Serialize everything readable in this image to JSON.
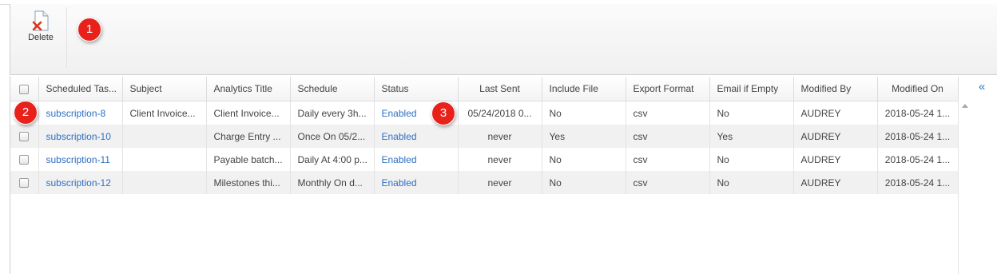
{
  "toolbar": {
    "delete_label": "Delete"
  },
  "badges": [
    "1",
    "2",
    "3"
  ],
  "table": {
    "columns": [
      "Scheduled Tas...",
      "Subject",
      "Analytics Title",
      "Schedule",
      "Status",
      "Last Sent",
      "Include File",
      "Export Format",
      "Email if Empty",
      "Modified By",
      "Modified On"
    ],
    "rows": [
      {
        "name": "subscription-8",
        "subject": "Client Invoice...",
        "title": "Client Invoice...",
        "schedule": "Daily every 3h...",
        "status": "Enabled",
        "last_sent": "05/24/2018 0...",
        "include_file": "No",
        "export_format": "csv",
        "email_if_empty": "No",
        "modified_by": "AUDREY",
        "modified_on": "2018-05-24 1..."
      },
      {
        "name": "subscription-10",
        "subject": "",
        "title": "Charge Entry ...",
        "schedule": "Once On 05/2...",
        "status": "Enabled",
        "last_sent": "never",
        "include_file": "Yes",
        "export_format": "csv",
        "email_if_empty": "Yes",
        "modified_by": "AUDREY",
        "modified_on": "2018-05-24 1..."
      },
      {
        "name": "subscription-11",
        "subject": "",
        "title": "Payable batch...",
        "schedule": "Daily At 4:00 p...",
        "status": "Enabled",
        "last_sent": "never",
        "include_file": "No",
        "export_format": "csv",
        "email_if_empty": "No",
        "modified_by": "AUDREY",
        "modified_on": "2018-05-24 1..."
      },
      {
        "name": "subscription-12",
        "subject": "",
        "title": "Milestones thi...",
        "schedule": "Monthly On d...",
        "status": "Enabled",
        "last_sent": "never",
        "include_file": "No",
        "export_format": "csv",
        "email_if_empty": "No",
        "modified_by": "AUDREY",
        "modified_on": "2018-05-24 1..."
      }
    ]
  },
  "right_panel": {
    "collapse_glyph": "«"
  },
  "colors": {
    "badge": "#e8221b",
    "link": "#2d6fc4"
  }
}
